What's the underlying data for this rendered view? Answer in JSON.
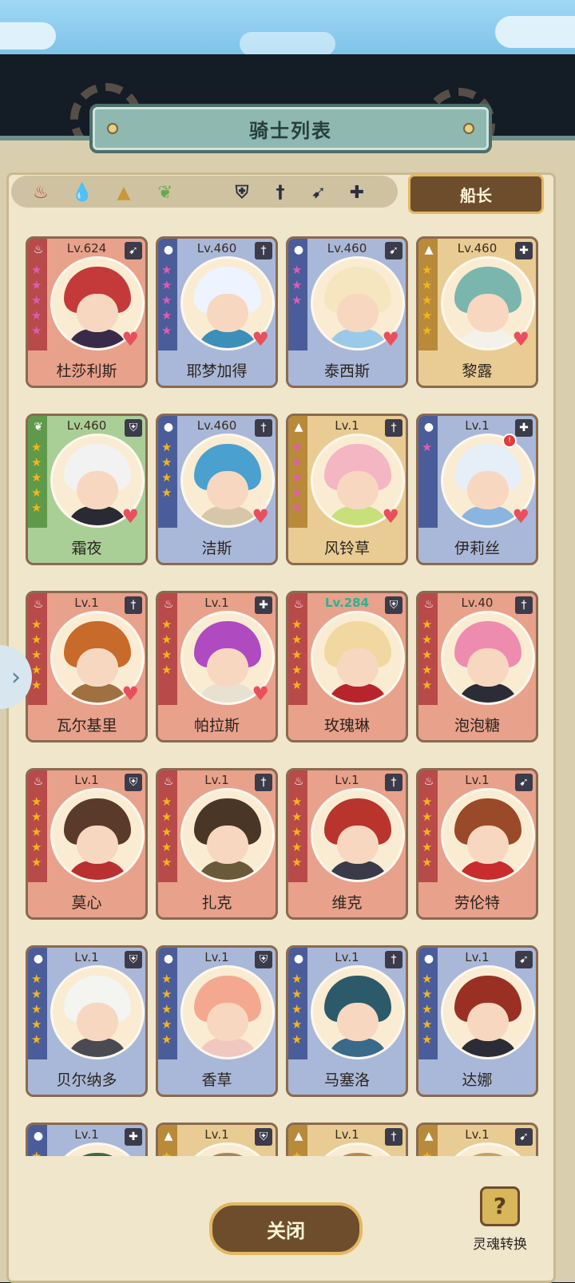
{
  "title": "骑士列表",
  "captain_button": "船长",
  "close_button": "关闭",
  "soul_convert_label": "灵魂转换",
  "filters": {
    "elements": [
      {
        "name": "fire-icon",
        "glyph": "♨",
        "color": "#c44048"
      },
      {
        "name": "water-icon",
        "glyph": "💧",
        "color": "#4f7fc6"
      },
      {
        "name": "earth-icon",
        "glyph": "▲",
        "color": "#c99839"
      },
      {
        "name": "wind-icon",
        "glyph": "❦",
        "color": "#6aa84f"
      }
    ],
    "classes": [
      {
        "name": "shield-icon",
        "glyph": "⛨"
      },
      {
        "name": "sword-icon",
        "glyph": "†"
      },
      {
        "name": "bow-icon",
        "glyph": "➹"
      },
      {
        "name": "cross-icon",
        "glyph": "✚"
      }
    ]
  },
  "colors": {
    "fire": "#e8a18b",
    "water": "#a9b8d8",
    "earth": "#e8cc93",
    "wind": "#a9cf97",
    "star_pink": "#e05cae",
    "star_gold": "#f2b51f"
  },
  "knights": [
    {
      "name": "杜莎利斯",
      "level": "Lv.624",
      "element": "fire",
      "class": "bow",
      "stars": 5,
      "star_color": "pink",
      "heart": true,
      "hair": "#c43a3a",
      "cloth": "#3a2a4a"
    },
    {
      "name": "耶梦加得",
      "level": "Lv.460",
      "element": "water",
      "class": "sword",
      "stars": 5,
      "star_color": "pink",
      "heart": true,
      "hair": "#eef4ff",
      "cloth": "#3c8fb8"
    },
    {
      "name": "泰西斯",
      "level": "Lv.460",
      "element": "water",
      "class": "bow",
      "stars": 3,
      "star_color": "pink",
      "heart": true,
      "hair": "#f6e6c0",
      "cloth": "#9bc9e8"
    },
    {
      "name": "黎露",
      "level": "Lv.460",
      "element": "earth",
      "class": "cross",
      "stars": 5,
      "star_color": "gold",
      "heart": true,
      "hair": "#7ab6ad",
      "cloth": "#f4f0ea"
    },
    {
      "name": "霜夜",
      "level": "Lv.460",
      "element": "wind",
      "class": "shield",
      "stars": 5,
      "star_color": "gold",
      "heart": true,
      "hair": "#f2f2f2",
      "cloth": "#2a2a34"
    },
    {
      "name": "洁斯",
      "level": "Lv.460",
      "element": "water",
      "class": "sword",
      "stars": 4,
      "star_color": "gold",
      "heart": true,
      "hair": "#4aa0cf",
      "cloth": "#d6c7a8"
    },
    {
      "name": "风铃草",
      "level": "Lv.1",
      "element": "earth",
      "class": "sword",
      "stars": 5,
      "star_color": "pink",
      "heart": true,
      "hair": "#f3b6c2",
      "cloth": "#c7e07a"
    },
    {
      "name": "伊莉丝",
      "level": "Lv.1",
      "element": "water",
      "class": "cross",
      "stars": 1,
      "star_color": "pink",
      "heart": true,
      "hair": "#e6eef8",
      "cloth": "#8ab5e0",
      "new": "!"
    },
    {
      "name": "瓦尔基里",
      "level": "Lv.1",
      "element": "fire",
      "class": "sword",
      "stars": 5,
      "star_color": "gold",
      "heart": true,
      "hair": "#c86a2a",
      "cloth": "#a07040"
    },
    {
      "name": "帕拉斯",
      "level": "Lv.1",
      "element": "fire",
      "class": "cross",
      "stars": 4,
      "star_color": "gold",
      "heart": true,
      "hair": "#b04ac0",
      "cloth": "#e8e0d0"
    },
    {
      "name": "玫瑰琳",
      "level": "Lv.284",
      "element": "fire",
      "class": "shield",
      "stars": 5,
      "star_color": "gold",
      "heart": false,
      "hair": "#f0d8a0",
      "cloth": "#b8242c",
      "level_color": "#22b59a"
    },
    {
      "name": "泡泡糖",
      "level": "Lv.40",
      "element": "fire",
      "class": "sword",
      "stars": 5,
      "star_color": "gold",
      "heart": false,
      "hair": "#ee8cb0",
      "cloth": "#2c2c36"
    },
    {
      "name": "莫心",
      "level": "Lv.1",
      "element": "fire",
      "class": "shield",
      "stars": 5,
      "star_color": "gold",
      "heart": false,
      "hair": "#5a3a2a",
      "cloth": "#b83030"
    },
    {
      "name": "扎克",
      "level": "Lv.1",
      "element": "fire",
      "class": "sword",
      "stars": 5,
      "star_color": "gold",
      "heart": false,
      "hair": "#4a3626",
      "cloth": "#6b5a3a"
    },
    {
      "name": "维克",
      "level": "Lv.1",
      "element": "fire",
      "class": "sword",
      "stars": 5,
      "star_color": "gold",
      "heart": false,
      "hair": "#b8342c",
      "cloth": "#3a3a48"
    },
    {
      "name": "劳伦特",
      "level": "Lv.1",
      "element": "fire",
      "class": "bow",
      "stars": 5,
      "star_color": "gold",
      "heart": false,
      "hair": "#9a4a28",
      "cloth": "#c82c2c"
    },
    {
      "name": "贝尔纳多",
      "level": "Lv.1",
      "element": "water",
      "class": "shield",
      "stars": 5,
      "star_color": "gold",
      "heart": false,
      "hair": "#f4f4f0",
      "cloth": "#4a4a52"
    },
    {
      "name": "香草",
      "level": "Lv.1",
      "element": "water",
      "class": "shield",
      "stars": 5,
      "star_color": "gold",
      "heart": false,
      "hair": "#f4a890",
      "cloth": "#f0c8c0"
    },
    {
      "name": "马塞洛",
      "level": "Lv.1",
      "element": "water",
      "class": "sword",
      "stars": 5,
      "star_color": "gold",
      "heart": false,
      "hair": "#2c5a6a",
      "cloth": "#3a6a8a"
    },
    {
      "name": "达娜",
      "level": "Lv.1",
      "element": "water",
      "class": "bow",
      "stars": 5,
      "star_color": "gold",
      "heart": false,
      "hair": "#9a3024",
      "cloth": "#2c2c36"
    },
    {
      "name": "",
      "level": "Lv.1",
      "element": "water",
      "class": "cross",
      "stars": 1,
      "star_color": "gold",
      "heart": false,
      "hair": "#3a6a4a",
      "cloth": "#4a6a5a"
    },
    {
      "name": "",
      "level": "Lv.1",
      "element": "earth",
      "class": "shield",
      "stars": 1,
      "star_color": "gold",
      "heart": false,
      "hair": "#a8845a",
      "cloth": "#a8845a"
    },
    {
      "name": "",
      "level": "Lv.1",
      "element": "earth",
      "class": "sword",
      "stars": 1,
      "star_color": "gold",
      "heart": false,
      "hair": "#b88a4a",
      "cloth": "#b88a4a"
    },
    {
      "name": "",
      "level": "Lv.1",
      "element": "earth",
      "class": "bow",
      "stars": 1,
      "star_color": "gold",
      "heart": false,
      "hair": "#c8a060",
      "cloth": "#c8a060"
    }
  ]
}
